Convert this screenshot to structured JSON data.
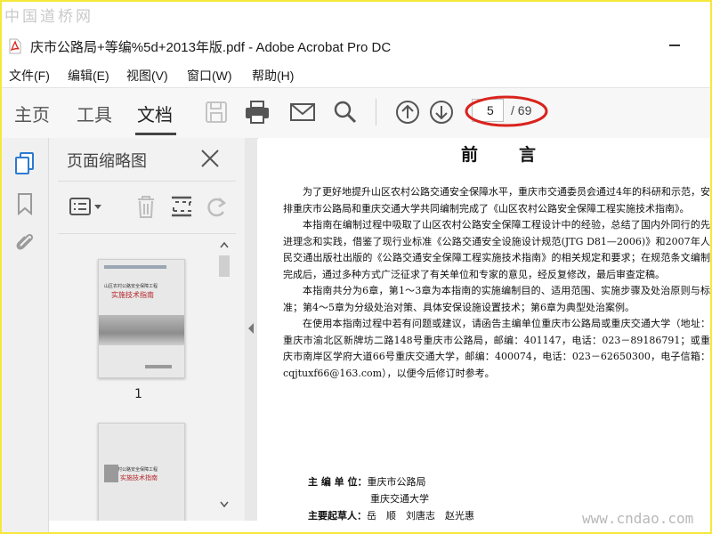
{
  "watermark_top": "中国道桥网",
  "watermark_bottom": "www.cndao.com",
  "window": {
    "title": "庆市公路局+等编%5d+2013年版.pdf - Adobe Acrobat Pro DC",
    "file_icon": "pdf-file-icon"
  },
  "menu": [
    "文件(F)",
    "编辑(E)",
    "视图(V)",
    "窗口(W)",
    "帮助(H)"
  ],
  "tabs": [
    "主页",
    "工具",
    "文档"
  ],
  "active_tab": "文档",
  "toolbar_icons": [
    "save-icon",
    "print-icon",
    "email-icon",
    "search-icon",
    "previous-page-icon",
    "next-page-icon"
  ],
  "page_nav": {
    "current": "5",
    "total": "/ 69"
  },
  "annotation_color": "#d9231d",
  "left_rail_icons": [
    "page-thumbnails-icon",
    "bookmarks-icon",
    "attachments-icon"
  ],
  "thumbnail_panel": {
    "title": "页面缩略图",
    "tool_icons": [
      "thumbnail-options-icon",
      "delete-page-icon",
      "extract-pages-icon",
      "rotate-page-icon"
    ],
    "thumbnails": [
      {
        "number": "1",
        "cover_title": "山区农村公路安全保障工程",
        "cover_subtitle": "实施技术指南"
      },
      {
        "cover_title": "山区农村公路安全保障工程",
        "cover_subtitle": "实施技术指南"
      }
    ]
  },
  "document": {
    "heading": "前言",
    "paragraphs": [
      "为了更好地提升山区农村公路交通安全保障水平，重庆市交通委员会通过4年的科研和示范，安排重庆市公路局和重庆交通大学共同编制完成了《山区农村公路安全保障工程实施技术指南》。",
      "本指南在编制过程中吸取了山区农村公路安全保障工程设计中的经验，总结了国内外同行的先进理念和实践，借鉴了现行业标准《公路交通安全设施设计规范(JTG D81—2006)》和2007年人民交通出版社出版的《公路交通安全保障工程实施技术指南》的相关规定和要求；在规范条文编制完成后，通过多种方式广泛征求了有关单位和专家的意见，经反复修改，最后审查定稿。",
      "本指南共分为6章，第1～3章为本指南的实施编制目的、适用范围、实施步骤及处治原则与标准；第4～5章为分级处治对策、具体安保设施设置技术；第6章为典型处治案例。",
      "在使用本指南过程中若有问题或建议，请函告主编单位重庆市公路局或重庆交通大学（地址：重庆市渝北区新牌坊二路148号重庆市公路局，邮编：401147，电话：023－89186791；或重庆市南岸区学府大道66号重庆交通大学，邮编：400074，电话：023－62650300，电子信箱：cqjtuxf66@163.com），以便今后修订时参考。"
    ],
    "chief_editor_label": "主 编 单 位：",
    "chief_editor_units": [
      "重庆市公路局",
      "重庆交通大学"
    ],
    "drafters_label": "主要起草人：",
    "drafters": "岳　顺　刘唐志　赵光惠"
  }
}
